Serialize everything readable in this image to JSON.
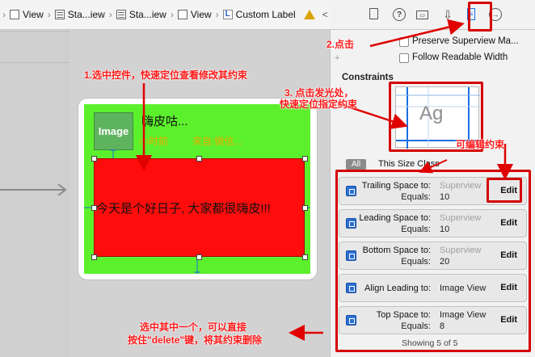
{
  "breadcrumb": {
    "items": [
      {
        "label": "View",
        "icon": "view-icon"
      },
      {
        "label": "Sta...iew",
        "icon": "stack-view-icon"
      },
      {
        "label": "Sta...iew",
        "icon": "stack-view-icon"
      },
      {
        "label": "View",
        "icon": "view-icon"
      },
      {
        "label": "Custom Label",
        "icon": "label-icon",
        "icon_glyph": "L"
      }
    ],
    "warning_icon": "warning-icon",
    "prev_glyph": "<",
    "next_glyph": ">"
  },
  "canvas": {
    "image_view_label": "Image",
    "name_label": "嗨皮咕...",
    "time_label": "小时前",
    "source_label": "来自:微信...",
    "content_label": "今天是个好日子, 大家都很嗨皮!!!"
  },
  "inspector": {
    "tabs": [
      "file-inspector-icon",
      "help-icon",
      "identity-inspector-icon",
      "attributes-inspector-icon",
      "size-inspector-icon",
      "connections-inspector-icon"
    ],
    "checkboxes": [
      {
        "label": "Preserve Superview Ma...",
        "checked": false
      },
      {
        "label": "Follow Readable Width",
        "checked": false
      }
    ],
    "plus_glyph": "+",
    "constraints_title": "Constraints",
    "preview_text": "Ag",
    "segment_all": "All",
    "segment_class": "This Size Class",
    "constraints": [
      {
        "label": "Trailing Space to:",
        "target": "Superview",
        "target_dim": true,
        "equals_label": "Equals:",
        "value": "10",
        "edit": "Edit"
      },
      {
        "label": "Leading Space to:",
        "target": "Superview",
        "target_dim": true,
        "equals_label": "Equals:",
        "value": "10",
        "edit": "Edit"
      },
      {
        "label": "Bottom Space to:",
        "target": "Superview",
        "target_dim": true,
        "equals_label": "Equals:",
        "value": "20",
        "edit": "Edit"
      },
      {
        "label": "Align Leading to:",
        "target": "Image View",
        "target_dim": false,
        "equals_label": "",
        "value": "",
        "edit": "Edit"
      },
      {
        "label": "Top Space to:",
        "target": "Image View",
        "target_dim": false,
        "equals_label": "Equals:",
        "value": "8",
        "edit": "Edit"
      }
    ],
    "showing": "Showing 5 of 5"
  },
  "annotations": {
    "step1": "1.选中控件，快速定位查看修改其约束",
    "step2": "2.点击",
    "step3_line1": "3. 点击发光处，",
    "step3_line2": "快速定位指定约束",
    "editable": "可编辑约束",
    "delete_line1": "选中其中一个，可以直接",
    "delete_line2": "按住\"delete\"键，将其约束删除"
  },
  "colors": {
    "cell_background": "#5cf02c",
    "content_background": "#ff0d0d",
    "image_background": "#5eb35f",
    "annotation_red": "#ff1a1a",
    "selected_tab": "#1a6fe0",
    "time_text": "#e8aa00"
  }
}
